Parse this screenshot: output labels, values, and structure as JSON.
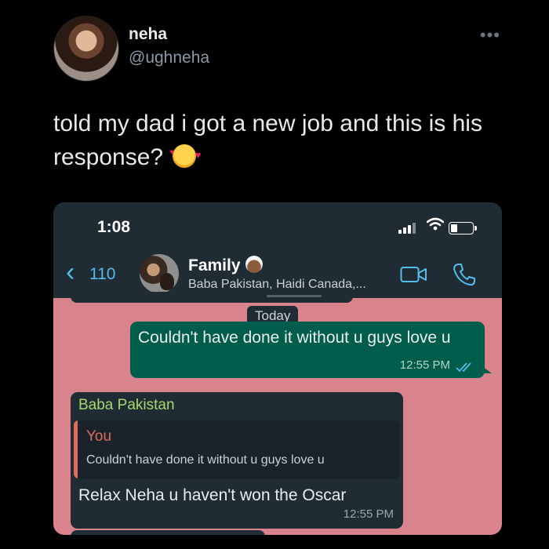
{
  "author": {
    "name": "neha",
    "handle": "@ughneha",
    "avatar_icon": "profile-photo",
    "menu_icon": "more-dots-icon",
    "menu_glyph": "•••"
  },
  "tweet": {
    "text": "told my dad i got a new job and this is his response?",
    "emoji_icon": "smiling-face-with-hearts-emoji"
  },
  "phone": {
    "status_bar": {
      "time": "1:08",
      "signal_icon": "signal-bars-icon",
      "wifi_icon": "wifi-icon",
      "battery_icon": "battery-icon"
    },
    "chat_header": {
      "back_glyph": "‹",
      "back_count": "110",
      "group_name": "Family",
      "group_emoji": "person-with-turban-emoji",
      "members": "Baba Pakistan, Haidi Canada,...",
      "video_icon": "video-call-icon",
      "call_icon": "phone-call-icon",
      "accent": "#53bdeb"
    },
    "chat": {
      "background": "#d9848d",
      "date_divider": "Today",
      "messages": [
        {
          "direction": "outgoing",
          "text": "Couldn't have done it without u guys love u",
          "time": "12:55 PM",
          "status_icon": "read-double-check-icon",
          "bubble_color": "#005c4b"
        },
        {
          "direction": "incoming",
          "sender": "Baba Pakistan",
          "sender_color": "#a5d86c",
          "reply_to": {
            "author": "You",
            "author_color": "#e26a5c",
            "text": "Couldn't have done it without u guys love u"
          },
          "text": "Relax Neha u haven't won the Oscar",
          "time": "12:55 PM",
          "bubble_color": "#202c33"
        }
      ]
    }
  }
}
